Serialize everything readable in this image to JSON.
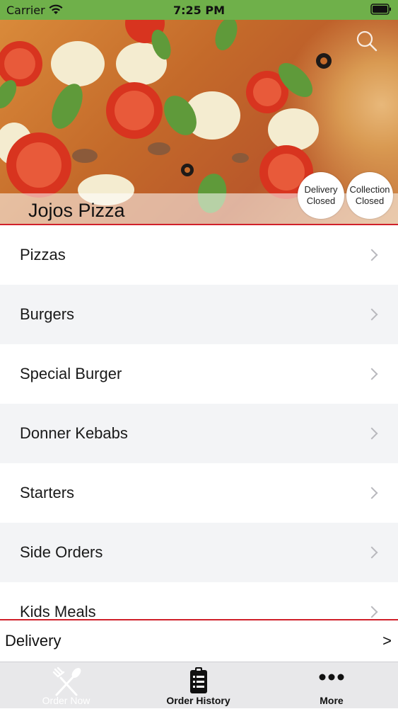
{
  "status_bar": {
    "carrier": "Carrier",
    "time": "7:25 PM"
  },
  "header": {
    "shop_name": "Jojos Pizza",
    "delivery_badge": {
      "line1": "Delivery",
      "line2": "Closed"
    },
    "collection_badge": {
      "line1": "Collection",
      "line2": "Closed"
    },
    "search_icon": "magnifier-icon"
  },
  "categories": [
    {
      "label": "Pizzas"
    },
    {
      "label": "Burgers"
    },
    {
      "label": "Special Burger"
    },
    {
      "label": "Donner Kebabs"
    },
    {
      "label": "Starters"
    },
    {
      "label": "Side Orders"
    },
    {
      "label": "Kids Meals"
    }
  ],
  "delivery_bar": {
    "label": "Delivery",
    "arrow": ">"
  },
  "tab_bar": {
    "tabs": [
      {
        "label": "Order Now",
        "icon": "fork-knife-icon",
        "active": false
      },
      {
        "label": "Order History",
        "icon": "clipboard-list-icon",
        "active": true
      },
      {
        "label": "More",
        "icon": "ellipsis-icon",
        "active": true
      }
    ]
  },
  "colors": {
    "status_bar_bg": "#6fb04a",
    "accent_red": "#d0202a",
    "row_alt_bg": "#f3f4f6"
  }
}
